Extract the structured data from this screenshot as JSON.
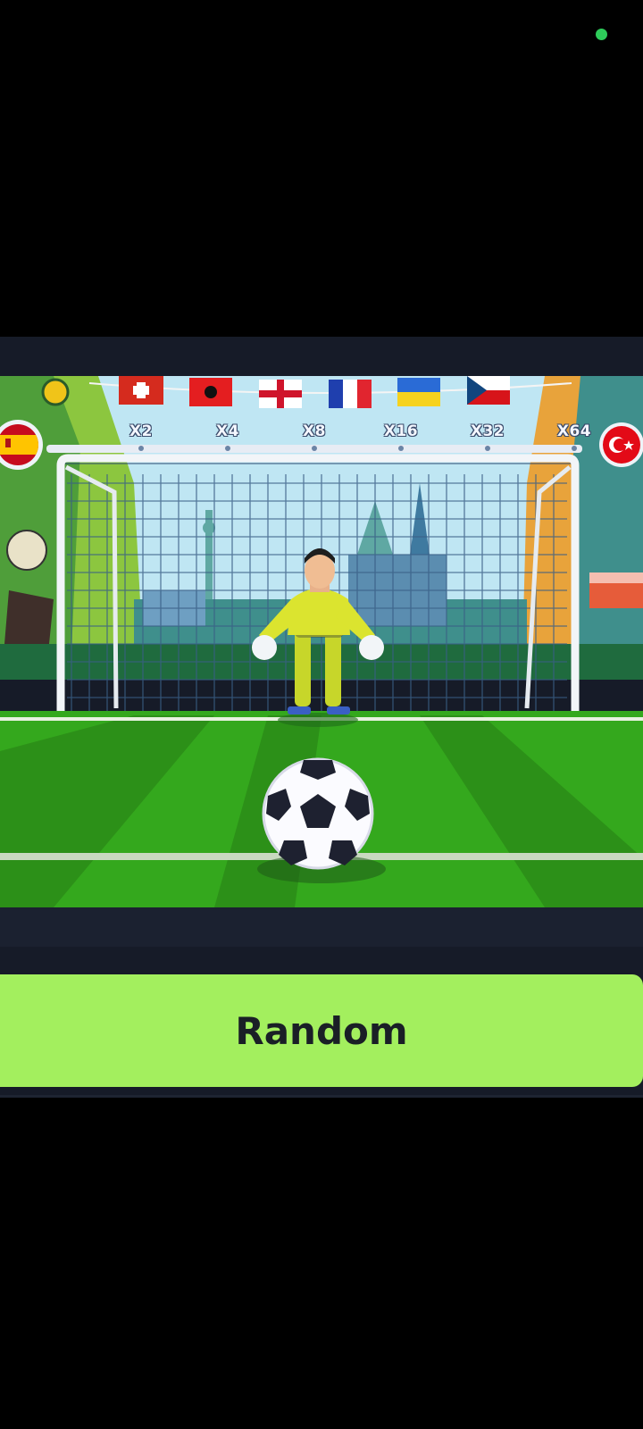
{
  "status": {
    "indicator_color": "#2ecc5a"
  },
  "game": {
    "name": "penalty-shootout",
    "player_team": "Spain",
    "opponent_team": "Turkey",
    "bunting_flags": [
      "Switzerland",
      "Albania",
      "England",
      "France",
      "Ukraine",
      "Czech Republic"
    ],
    "multipliers": [
      "X2",
      "X4",
      "X8",
      "X16",
      "X32",
      "X64"
    ],
    "progress_level": 0
  },
  "controls": {
    "random_label": "Random"
  },
  "colors": {
    "button_green": "#a3ef5e",
    "panel_dark": "#161b28",
    "pitch_green": "#34a81d"
  }
}
